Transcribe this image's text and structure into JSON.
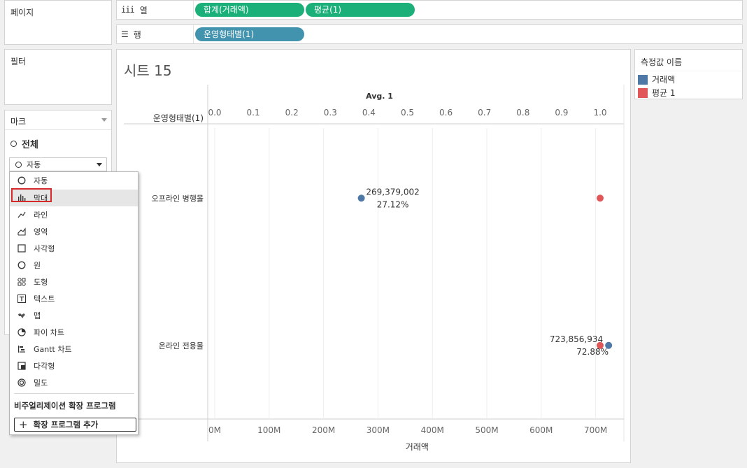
{
  "left_panel": {
    "pages_title": "페이지",
    "filters_title": "필터",
    "marks_title": "마크",
    "marks_all": "전체",
    "mark_type_selected": "자동"
  },
  "shelves": {
    "columns_label": "열",
    "columns_icon": "iii",
    "columns_pills": [
      "합계(거래액)",
      "평균(1)"
    ],
    "rows_label": "행",
    "rows_icon": "☰",
    "rows_pills": [
      "운영형태별(1)"
    ]
  },
  "mark_menu": {
    "items": [
      {
        "label": "자동",
        "icon": "circle-icon"
      },
      {
        "label": "막대",
        "icon": "bar-icon"
      },
      {
        "label": "라인",
        "icon": "line-icon"
      },
      {
        "label": "영역",
        "icon": "area-icon"
      },
      {
        "label": "사각형",
        "icon": "square-icon"
      },
      {
        "label": "원",
        "icon": "circle-icon"
      },
      {
        "label": "도형",
        "icon": "shapes-icon"
      },
      {
        "label": "텍스트",
        "icon": "text-icon"
      },
      {
        "label": "맵",
        "icon": "map-icon"
      },
      {
        "label": "파이 차트",
        "icon": "pie-icon"
      },
      {
        "label": "Gantt 차트",
        "icon": "gantt-icon"
      },
      {
        "label": "다각형",
        "icon": "polygon-icon"
      },
      {
        "label": "밀도",
        "icon": "density-icon"
      }
    ],
    "highlighted_item": "막대",
    "extensions_title": "비주얼리제이션 확장 프로그램",
    "add_extension_label": "확장 프로그램 추가"
  },
  "legend": {
    "title": "측정값 이름",
    "items": [
      {
        "label": "거래액",
        "color": "#4e79a7"
      },
      {
        "label": "평균 1",
        "color": "#e15759"
      }
    ]
  },
  "sheet": {
    "title": "시트 15"
  },
  "chart_data": {
    "type": "scatter",
    "row_header": "운영형태별(1)",
    "categories": [
      "오프라인 병행몰",
      "온라인 전용몰"
    ],
    "top_axis": {
      "title": "Avg. 1",
      "ticks": [
        "0.0",
        "0.1",
        "0.2",
        "0.3",
        "0.4",
        "0.5",
        "0.6",
        "0.7",
        "0.8",
        "0.9",
        "1.0"
      ],
      "range": [
        0,
        1.0
      ]
    },
    "bottom_axis": {
      "title": "거래액",
      "ticks": [
        "0M",
        "100M",
        "200M",
        "300M",
        "400M",
        "500M",
        "600M",
        "700M"
      ],
      "range": [
        0,
        740000000
      ]
    },
    "series": [
      {
        "name": "거래액",
        "color": "#4e79a7",
        "values": [
          269379002,
          723856934
        ]
      },
      {
        "name": "평균 1",
        "color": "#e15759",
        "values": [
          1.0,
          1.0
        ]
      }
    ],
    "labels": [
      {
        "category": "오프라인 병행몰",
        "amount": "269,379,002",
        "percent": "27.12%"
      },
      {
        "category": "온라인 전용몰",
        "amount": "723,856,934",
        "percent": "72.88%"
      }
    ]
  }
}
